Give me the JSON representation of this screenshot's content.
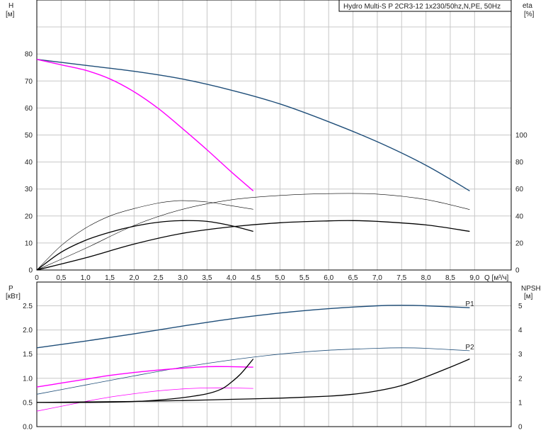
{
  "title": "Hydro Multi-S P 2CR3-12 1x230/50hz,N,PE, 50Hz",
  "colors": {
    "head": "#1f4e79",
    "half": "#ff00ff",
    "curve": "#000000",
    "grid": "#c8c8c8",
    "frame": "#000000"
  },
  "chart_data": [
    {
      "type": "line",
      "name": "top",
      "y_left_label": [
        "H",
        "[м]"
      ],
      "y_right_label": [
        "eta",
        "[%]"
      ],
      "x_label": "Q [м³/ч]",
      "x_ticks": [
        "0",
        "0,5",
        "1,0",
        "1,5",
        "2,0",
        "2,5",
        "3,0",
        "3,5",
        "4,0",
        "4,5",
        "5,0",
        "5,5",
        "6,0",
        "6,5",
        "7,0",
        "7,5",
        "8,0",
        "8,5",
        "9,0"
      ],
      "y_left_ticks": [
        "0",
        "10",
        "20",
        "30",
        "40",
        "50",
        "60",
        "70",
        "80"
      ],
      "y_right_ticks": [
        "0",
        "20",
        "40",
        "60",
        "80",
        "100"
      ],
      "xlim": [
        0,
        9.0
      ],
      "ylim": [
        0,
        90
      ],
      "y_right_lim": [
        0,
        180
      ],
      "series": [
        {
          "axis": "left",
          "color": "#1f4e79",
          "width": 1.4,
          "points": [
            [
              0,
              78
            ],
            [
              1,
              75.8
            ],
            [
              2,
              73.6
            ],
            [
              3,
              70.7
            ],
            [
              4,
              66.6
            ],
            [
              5,
              61.5
            ],
            [
              6,
              54.9
            ],
            [
              7,
              47.5
            ],
            [
              8,
              38.8
            ],
            [
              8.9,
              29.3
            ]
          ]
        },
        {
          "axis": "left",
          "color": "#ff00ff",
          "width": 1.4,
          "points": [
            [
              0,
              78
            ],
            [
              0.5,
              76
            ],
            [
              1,
              74
            ],
            [
              1.5,
              70.8
            ],
            [
              2,
              66
            ],
            [
              2.5,
              59.8
            ],
            [
              3,
              52.3
            ],
            [
              3.5,
              44.5
            ],
            [
              4,
              36.3
            ],
            [
              4.45,
              29.3
            ]
          ]
        },
        {
          "axis": "right",
          "color": "#000000",
          "width": 0.6,
          "points": [
            [
              0,
              0
            ],
            [
              0.5,
              18
            ],
            [
              1,
              31
            ],
            [
              1.5,
              40
            ],
            [
              2,
              45.5
            ],
            [
              2.5,
              49.6
            ],
            [
              2.8,
              51
            ],
            [
              3,
              51.4
            ],
            [
              3.5,
              50.4
            ],
            [
              4,
              47.6
            ],
            [
              4.45,
              45
            ]
          ]
        },
        {
          "axis": "right",
          "color": "#000000",
          "width": 0.6,
          "points": [
            [
              0,
              0
            ],
            [
              1,
              16
            ],
            [
              2,
              33
            ],
            [
              3,
              45
            ],
            [
              4,
              52
            ],
            [
              5,
              55.2
            ],
            [
              6,
              56.6
            ],
            [
              7,
              56.2
            ],
            [
              8,
              52.2
            ],
            [
              8.9,
              44.8
            ]
          ]
        },
        {
          "axis": "left",
          "color": "#000000",
          "width": 1.3,
          "points": [
            [
              0,
              0
            ],
            [
              0.5,
              6.6
            ],
            [
              1,
              11
            ],
            [
              1.5,
              14
            ],
            [
              2,
              16.2
            ],
            [
              2.5,
              17.7
            ],
            [
              3,
              18.3
            ],
            [
              3.5,
              18
            ],
            [
              4,
              16.4
            ],
            [
              4.45,
              14.3
            ]
          ]
        },
        {
          "axis": "left",
          "color": "#000000",
          "width": 1.3,
          "points": [
            [
              0,
              0
            ],
            [
              1,
              4.5
            ],
            [
              2,
              9.6
            ],
            [
              3,
              13.6
            ],
            [
              4,
              16
            ],
            [
              5,
              17.5
            ],
            [
              6,
              18.2
            ],
            [
              6.5,
              18.3
            ],
            [
              7,
              18
            ],
            [
              8,
              16.7
            ],
            [
              8.9,
              14.3
            ]
          ]
        }
      ]
    },
    {
      "type": "line",
      "name": "bottom",
      "y_left_label": [
        "P",
        "[кВт]"
      ],
      "y_right_label": [
        "NPSH",
        "[м]"
      ],
      "y_left_ticks": [
        "0.0",
        "0.5",
        "1.0",
        "1.5",
        "2.0",
        "2.5"
      ],
      "y_right_ticks": [
        "0",
        "1",
        "2",
        "3",
        "4",
        "5"
      ],
      "xlim": [
        0,
        9.0
      ],
      "ylim": [
        0,
        2.9
      ],
      "y_right_lim": [
        0,
        5.8
      ],
      "series_labels": [
        "P1",
        "P2"
      ],
      "series": [
        {
          "axis": "left",
          "color": "#1f4e79",
          "width": 1.4,
          "label": "P1",
          "points": [
            [
              0,
              1.63
            ],
            [
              1,
              1.77
            ],
            [
              2,
              1.92
            ],
            [
              3,
              2.08
            ],
            [
              4,
              2.23
            ],
            [
              5,
              2.35
            ],
            [
              6,
              2.44
            ],
            [
              7,
              2.5
            ],
            [
              7.5,
              2.51
            ],
            [
              8,
              2.5
            ],
            [
              8.9,
              2.46
            ]
          ]
        },
        {
          "axis": "left",
          "color": "#1f4e79",
          "width": 0.8,
          "label": "P2",
          "points": [
            [
              0,
              0.67
            ],
            [
              1,
              0.86
            ],
            [
              2,
              1.05
            ],
            [
              3,
              1.23
            ],
            [
              4,
              1.38
            ],
            [
              5,
              1.5
            ],
            [
              6,
              1.58
            ],
            [
              7,
              1.62
            ],
            [
              7.5,
              1.63
            ],
            [
              8,
              1.62
            ],
            [
              8.9,
              1.57
            ]
          ]
        },
        {
          "axis": "left",
          "color": "#ff00ff",
          "width": 1.4,
          "points": [
            [
              0,
              0.82
            ],
            [
              0.5,
              0.9
            ],
            [
              1,
              0.98
            ],
            [
              1.5,
              1.06
            ],
            [
              2,
              1.12
            ],
            [
              2.5,
              1.17
            ],
            [
              3,
              1.21
            ],
            [
              3.5,
              1.24
            ],
            [
              4,
              1.24
            ],
            [
              4.45,
              1.23
            ]
          ]
        },
        {
          "axis": "left",
          "color": "#ff00ff",
          "width": 0.8,
          "points": [
            [
              0,
              0.32
            ],
            [
              0.5,
              0.42
            ],
            [
              1,
              0.52
            ],
            [
              1.5,
              0.61
            ],
            [
              2,
              0.68
            ],
            [
              2.5,
              0.74
            ],
            [
              3,
              0.78
            ],
            [
              3.5,
              0.8
            ],
            [
              4,
              0.8
            ],
            [
              4.45,
              0.79
            ]
          ]
        },
        {
          "axis": "right",
          "color": "#000000",
          "width": 1.3,
          "points": [
            [
              0,
              1
            ],
            [
              1,
              1
            ],
            [
              2,
              1.04
            ],
            [
              2.5,
              1.1
            ],
            [
              3,
              1.2
            ],
            [
              3.5,
              1.36
            ],
            [
              3.8,
              1.56
            ],
            [
              4,
              1.84
            ],
            [
              4.2,
              2.2
            ],
            [
              4.45,
              2.8
            ]
          ]
        },
        {
          "axis": "right",
          "color": "#000000",
          "width": 1.3,
          "points": [
            [
              0,
              1
            ],
            [
              1,
              1.02
            ],
            [
              2,
              1.04
            ],
            [
              3,
              1.08
            ],
            [
              4,
              1.13
            ],
            [
              5,
              1.18
            ],
            [
              6,
              1.26
            ],
            [
              6.5,
              1.34
            ],
            [
              7,
              1.48
            ],
            [
              7.5,
              1.7
            ],
            [
              8,
              2.06
            ],
            [
              8.5,
              2.46
            ],
            [
              8.9,
              2.8
            ]
          ]
        }
      ]
    }
  ]
}
